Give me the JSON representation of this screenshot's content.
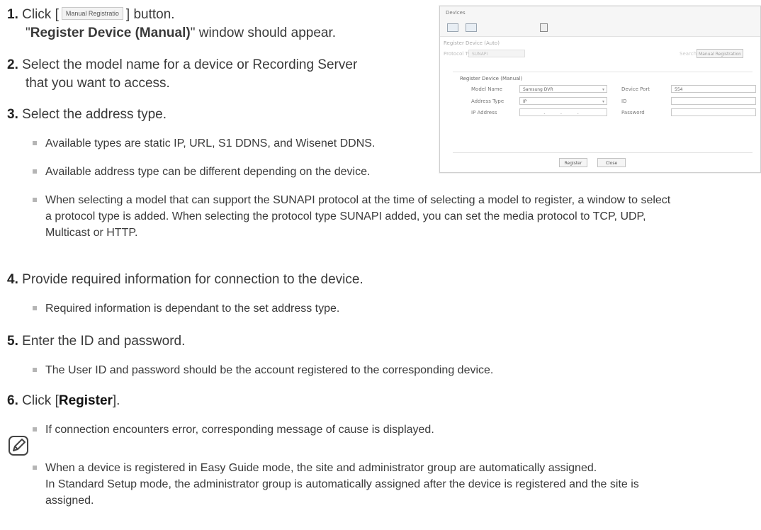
{
  "steps": [
    {
      "num": "1.",
      "pre": "Click [",
      "inline_button": "Manual Registratio",
      "post": "] button."
    },
    {
      "num": "2.",
      "text": "Select the model name for a device or Recording Server",
      "text2": "that you want to access."
    },
    {
      "num": "3.",
      "text": "Select the address type."
    },
    {
      "num": "4.",
      "text": "Provide required information for connection to the device."
    },
    {
      "num": "5.",
      "text": "Enter the ID and password."
    },
    {
      "num": "6.",
      "pre": "Click [",
      "bold": "Register",
      "post": "]."
    }
  ],
  "step1_line2": {
    "q1": "\"",
    "bold": "Register Device (Manual)",
    "rest": "\" window should appear."
  },
  "bullets": {
    "b3a": "Available types are static IP, URL, S1 DDNS, and Wisenet DDNS.",
    "b3b": "Available address type can be different depending on the device.",
    "b3c_1": "When selecting a model that can support the SUNAPI protocol at the time of selecting a model to register, a window to select",
    "b3c_2": "a protocol type is added. When selecting the protocol type SUNAPI added, you can set the media protocol to TCP, UDP,",
    "b3c_3": "Multicast or HTTP.",
    "b4": "Required information is dependant to the set address type.",
    "b5": "The User ID and password should be the account registered to the corresponding device.",
    "b6": "If connection encounters error, corresponding message of cause is displayed.",
    "note_1": "When a device is registered in Easy Guide mode, the site and administrator group are automatically assigned.",
    "note_2": "In Standard Setup mode, the administrator group is automatically assigned after the device is registered and the site is",
    "note_3": "assigned."
  },
  "screenshot": {
    "tab_title": "Devices",
    "auto_section": "Register Device (Auto)",
    "protocol_type_label": "Protocol Type",
    "protocol_type_value": "SUNAPI",
    "search_label": "Search",
    "manual_reg_button": "Manual Registration",
    "manual_section": "Register Device (Manual)",
    "model_name_label": "Model Name",
    "model_name_value": "Samsung DVR",
    "address_type_label": "Address Type",
    "address_type_value": "IP",
    "ip_address_label": "IP Address",
    "ip_address_value": ". . .",
    "device_port_label": "Device Port",
    "device_port_value": "554",
    "id_label": "ID",
    "password_label": "Password",
    "register_button": "Register",
    "close_button": "Close"
  }
}
